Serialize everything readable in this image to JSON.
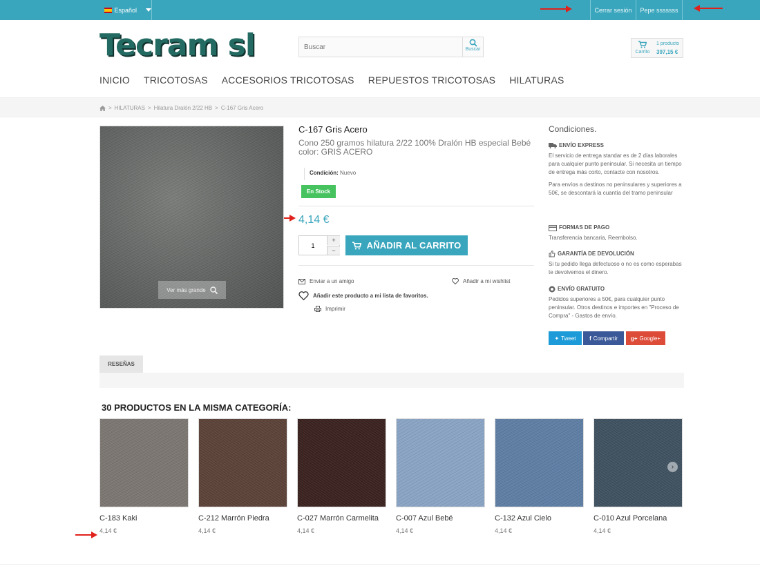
{
  "topbar": {
    "language": "Español",
    "logout": "Cerrar sesión",
    "account": "Pepe sssssss"
  },
  "header": {
    "logo": "Tecram sl",
    "search": {
      "placeholder": "Buscar",
      "button_label": "Buscar"
    },
    "cart": {
      "label": "Carrito",
      "count": "1 producto",
      "total": "397,15 €"
    }
  },
  "nav": [
    "INICIO",
    "TRICOTOSAS",
    "ACCESORIOS TRICOTOSAS",
    "REPUESTOS TRICOTOSAS",
    "HILATURAS"
  ],
  "breadcrumb": [
    "HILATURAS",
    "Hilatura Dralón 2/22 HB",
    "C-167 Gris Acero"
  ],
  "product": {
    "title": "C-167 Gris Acero",
    "description": "Cono 250 gramos hilatura 2/22 100% Dralón HB especial Bebé color: GRIS ACERO",
    "condition_label": "Condición:",
    "condition_value": "Nuevo",
    "stock": "En Stock",
    "price": "4,14 €",
    "quantity": "1",
    "add_to_cart": "AÑADIR AL CARRITO",
    "zoom_label": "Ver más grande",
    "send_friend": "Enviar a un amigo",
    "wishlist": "Añadir a mi wishlist",
    "favorites": "Añadir este producto a mi lista de favoritos.",
    "print": "Imprimir",
    "image_color": "#646765"
  },
  "conditions": {
    "title": "Condiciones.",
    "express_head": "ENVÍO EXPRESS",
    "express_text1": "El servicio de entrega standar es de 2 días laborales para cualquier punto peninsular. Si necesita un tiempo de entrega más corto, contacte con nosotros.",
    "express_text2": "Para envíos a destinos no peninsulares y superiores a 50€, se descontará la cuantía del tramo peninsular",
    "payment_head": "FORMAS DE PAGO",
    "payment_text": "Transferencia bancaria, Reembolso.",
    "return_head": "GARANTÍA DE DEVOLUCIÓN",
    "return_text": "Si tu pedido llega defectuoso o no es como esperabas te devolvemos el dinero.",
    "free_head": "ENVÍO GRATUITO",
    "free_text": "Pedidos superiores a 50€, para cualquier punto peninsular. Otros destinos e importes en \"Proceso de Compra\" - Gastos de envío."
  },
  "social": {
    "tweet": "Tweet",
    "share": "Compartir",
    "google": "Google+"
  },
  "tabs": {
    "reviews": "RESEÑAS"
  },
  "related": {
    "title": "30 PRODUCTOS EN LA MISMA CATEGORÍA:",
    "items": [
      {
        "name": "C-183 Kaki",
        "price": "4,14 €",
        "color": "#7b7671"
      },
      {
        "name": "C-212 Marrón Piedra",
        "price": "4,14 €",
        "color": "#5b4238"
      },
      {
        "name": "C-027 Marrón Carmelita",
        "price": "4,14 €",
        "color": "#3a221f"
      },
      {
        "name": "C-007 Azul Bebé",
        "price": "4,14 €",
        "color": "#8aa4c4"
      },
      {
        "name": "C-132 Azul Cielo",
        "price": "4,14 €",
        "color": "#5e7ea4"
      },
      {
        "name": "C-010 Azul Porcelana",
        "price": "4,14 €",
        "color": "#3f5160"
      }
    ]
  },
  "colors": {
    "accent": "#3aa6bd",
    "stock_green": "#46c35f",
    "tweet_blue": "#1d9bd8",
    "facebook_blue": "#3b5998",
    "google_red": "#dd4b39",
    "arrow_red": "#e0211b"
  }
}
